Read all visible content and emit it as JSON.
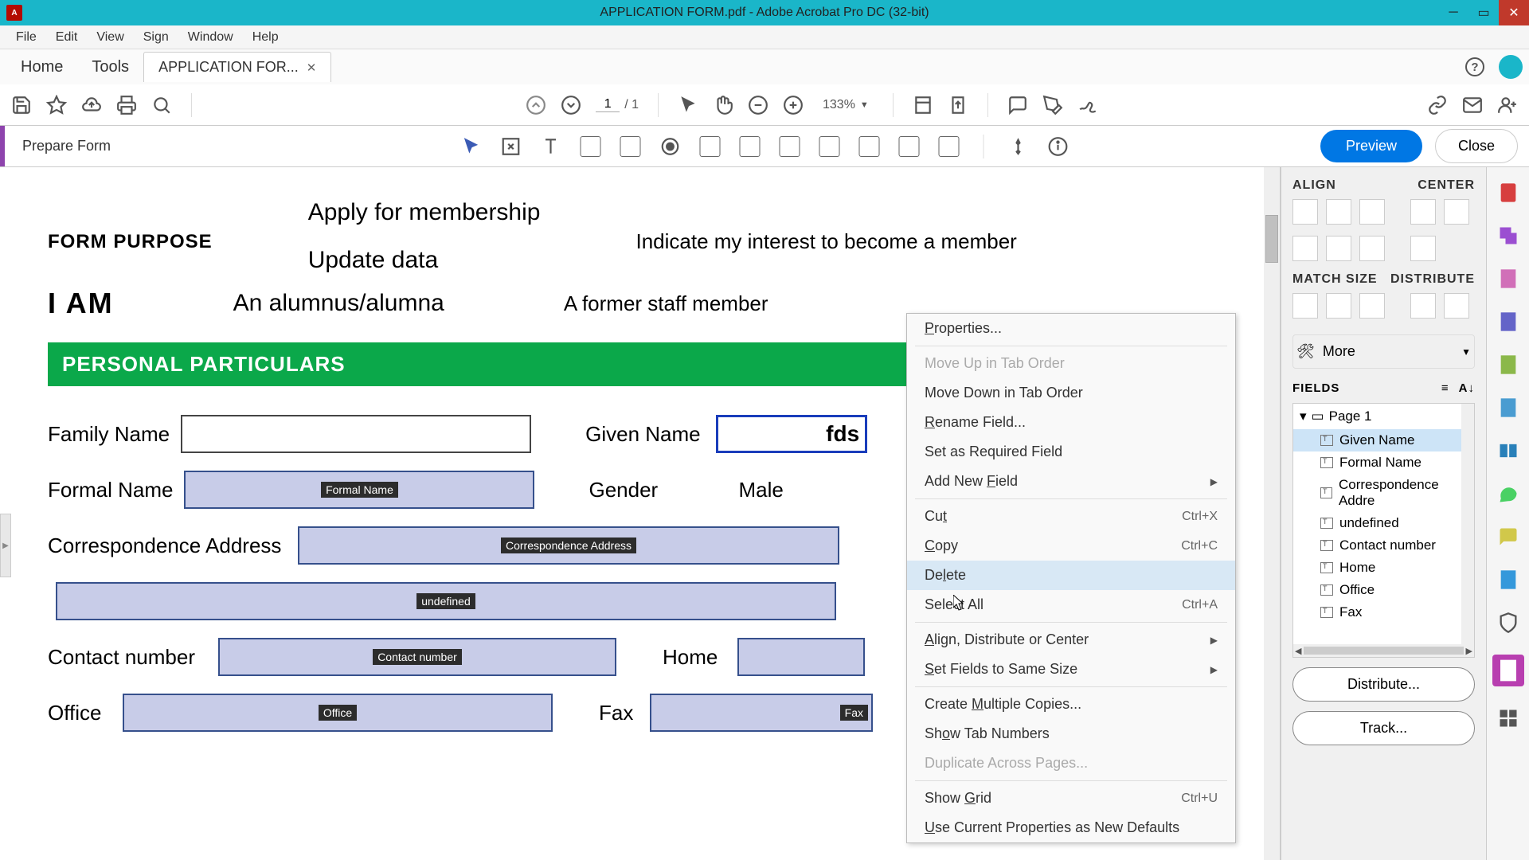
{
  "title": "APPLICATION FORM.pdf - Adobe Acrobat Pro DC (32-bit)",
  "menu": [
    "File",
    "Edit",
    "View",
    "Sign",
    "Window",
    "Help"
  ],
  "tabs": {
    "home": "Home",
    "tools": "Tools",
    "doc": "APPLICATION FOR..."
  },
  "toolbar": {
    "page_current": "1",
    "page_total": "/  1",
    "zoom": "133%"
  },
  "prepare": {
    "label": "Prepare Form",
    "preview": "Preview",
    "close": "Close"
  },
  "doc": {
    "form_purpose_label": "FORM PURPOSE",
    "apply": "Apply for membership",
    "indicate": "Indicate my interest to become a member",
    "update": "Update data",
    "i_am": "I AM",
    "alumnus": "An alumnus/alumna",
    "former": "A former staff member",
    "section": "PERSONAL PARTICULARS",
    "family_name": "Family Name",
    "given_name": "Given Name",
    "given_val": "fds",
    "formal_name": "Formal Name",
    "formal_tag": "Formal Name",
    "gender": "Gender",
    "male": "Male",
    "corr": "Correspondence Address",
    "corr_tag": "Correspondence Address",
    "undef_tag": "undefined",
    "contact": "Contact number",
    "contact_tag": "Contact number",
    "home": "Home",
    "office": "Office",
    "office_tag": "Office",
    "fax": "Fax",
    "fax_tag": "Fax"
  },
  "context_menu": {
    "properties": "Properties...",
    "move_up": "Move Up in Tab Order",
    "move_down": "Move Down in Tab Order",
    "rename": "Rename Field...",
    "required": "Set as Required Field",
    "add_new": "Add New Field",
    "cut": "Cut",
    "cut_k": "Ctrl+X",
    "copy": "Copy",
    "copy_k": "Ctrl+C",
    "delete": "Delete",
    "select_all": "Select All",
    "select_all_k": "Ctrl+A",
    "align": "Align, Distribute or Center",
    "same_size": "Set Fields to Same Size",
    "multiple": "Create Multiple Copies...",
    "show_tab": "Show Tab Numbers",
    "dup_pages": "Duplicate Across Pages...",
    "show_grid": "Show Grid",
    "show_grid_k": "Ctrl+U",
    "use_current": "Use Current Properties as New Defaults"
  },
  "right_panel": {
    "align": "ALIGN",
    "center": "CENTER",
    "match": "MATCH SIZE",
    "distribute": "DISTRIBUTE",
    "more": "More",
    "fields": "FIELDS",
    "page1": "Page 1",
    "items": [
      "Given Name",
      "Formal Name",
      "Correspondence Addre",
      "undefined",
      "Contact number",
      "Home",
      "Office",
      "Fax"
    ],
    "distribute_btn": "Distribute...",
    "track_btn": "Track..."
  }
}
